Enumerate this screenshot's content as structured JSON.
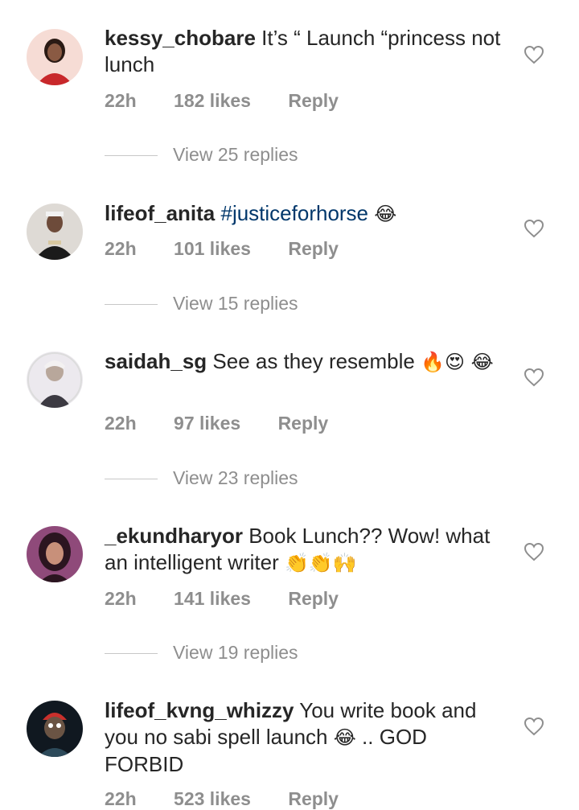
{
  "comments": [
    {
      "username": "kessy_chobare",
      "text": "It’s “ Launch “princess not lunch",
      "time": "22h",
      "likes": "182 likes",
      "reply": "Reply",
      "view_replies": "View 25 replies",
      "avatar_colors": [
        "#f4d9d2",
        "#c8282b",
        "#2a1a14"
      ]
    },
    {
      "username": "lifeof_anita",
      "hashtag": "#justiceforhorse",
      "emoji": "😂",
      "time": "22h",
      "likes": "101 likes",
      "reply": "Reply",
      "view_replies": "View 15 replies",
      "avatar_colors": [
        "#d7d4cf",
        "#1b1b1b",
        "#8a6a55"
      ]
    },
    {
      "username": "saidah_sg",
      "text": "See as they resemble",
      "emoji": "🔥😍 😂",
      "time": "22h",
      "likes": "97 likes",
      "reply": "Reply",
      "view_replies": "View 23 replies",
      "avatar_colors": [
        "#e9e6ea",
        "#3c3a42",
        "#b8a79b"
      ]
    },
    {
      "username": "_ekundharyor",
      "text": "Book Lunch?? Wow! what an intelligent writer",
      "emoji": "👏👏🙌",
      "time": "22h",
      "likes": "141 likes",
      "reply": "Reply",
      "view_replies": "View 19 replies",
      "avatar_colors": [
        "#8f4a7a",
        "#2b1520",
        "#c8907a"
      ]
    },
    {
      "username": "lifeof_kvng_whizzy",
      "text": "You write book and you no sabi spell launch",
      "emoji": "😂",
      "text2": ".. GOD FORBID",
      "time": "22h",
      "likes": "523 likes",
      "reply": "Reply",
      "avatar_colors": [
        "#101820",
        "#c9302c",
        "#6a5444"
      ]
    }
  ]
}
